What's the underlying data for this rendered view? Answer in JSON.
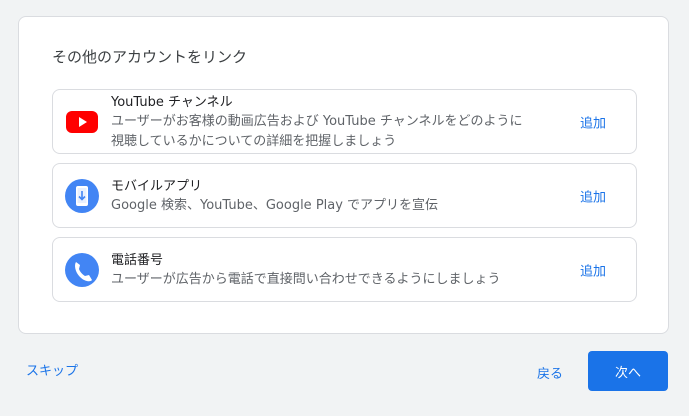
{
  "card": {
    "title": "その他のアカウントをリンク"
  },
  "accounts": [
    {
      "icon": "youtube-icon",
      "title": "YouTube チャンネル",
      "description": "ユーザーがお客様の動画広告および YouTube チャンネルをどのように視聴しているかについての詳細を把握しましょう",
      "action_label": "追加"
    },
    {
      "icon": "mobile-app-icon",
      "title": "モバイルアプリ",
      "description": "Google 検索、YouTube、Google Play でアプリを宣伝",
      "action_label": "追加"
    },
    {
      "icon": "phone-icon",
      "title": "電話番号",
      "description": "ユーザーが広告から電話で直接問い合わせできるようにしましょう",
      "action_label": "追加"
    }
  ],
  "footer": {
    "skip_label": "スキップ",
    "back_label": "戻る",
    "next_label": "次へ"
  },
  "colors": {
    "accent": "#1a73e8",
    "youtube_red": "#ff0000",
    "icon_blue": "#4285f4"
  }
}
